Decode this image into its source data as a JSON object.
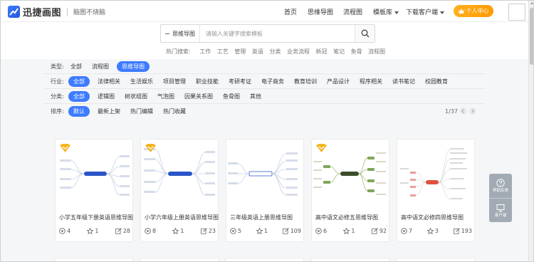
{
  "header": {
    "brand": "迅捷画图",
    "slogan": "脑图不烧脑",
    "nav": {
      "home": "首页",
      "mindmap": "思维导图",
      "flowchart": "流程图",
      "templates": "模板库",
      "download": "下载客户端"
    },
    "user_center": "个人中心"
  },
  "search": {
    "category": "思维导图",
    "placeholder": "请输入关键字搜索模板",
    "hot_label": "热门搜索:",
    "hot_terms": [
      "工作",
      "工艺",
      "管理",
      "英语",
      "分类",
      "业务流程",
      "新冠",
      "笔记",
      "鱼骨",
      "流程图"
    ]
  },
  "filters": {
    "type": {
      "label": "类型:",
      "options": [
        "全部",
        "流程图",
        "思维导图"
      ],
      "active": "思维导图"
    },
    "industry": {
      "label": "行业:",
      "options": [
        "全部",
        "法律相关",
        "生活娱乐",
        "项目管理",
        "职业技能",
        "考研考证",
        "电子商务",
        "教育培训",
        "产品设计",
        "程序相关",
        "读书笔记",
        "校园教育"
      ],
      "active": "全部"
    },
    "category": {
      "label": "分类:",
      "options": [
        "全部",
        "逻辑图",
        "树状组图",
        "气泡图",
        "因果关系图",
        "鱼骨图",
        "其他"
      ],
      "active": "全部"
    },
    "sort": {
      "label": "排序:",
      "options": [
        "默认",
        "最新上架",
        "热门编辑",
        "热门收藏"
      ],
      "active": "默认"
    },
    "pager": "1/37"
  },
  "cards": [
    {
      "title": "小学五年级下册英语思维导图",
      "views": "4",
      "likes": "1",
      "edits": "28",
      "vip": true,
      "style": "blue"
    },
    {
      "title": "小学六年级上册英语思维导图",
      "views": "8",
      "likes": "1",
      "edits": "23",
      "vip": true,
      "style": "blue"
    },
    {
      "title": "三年级英语上册思维导图",
      "views": "5",
      "likes": "1",
      "edits": "109",
      "vip": false,
      "style": "blue"
    },
    {
      "title": "高中语文必修五思维导图",
      "views": "6",
      "likes": "1",
      "edits": "92",
      "vip": true,
      "style": "green"
    },
    {
      "title": "高中语文必修四思维导图",
      "views": "7",
      "likes": "3",
      "edits": "193",
      "vip": false,
      "style": "red"
    }
  ],
  "side_float": {
    "help": "帮助反馈",
    "client": "客户端"
  },
  "colors": {
    "accent": "#3d7bff",
    "user_button": "#ffa40f",
    "vip_badge": "#f5b51f"
  }
}
